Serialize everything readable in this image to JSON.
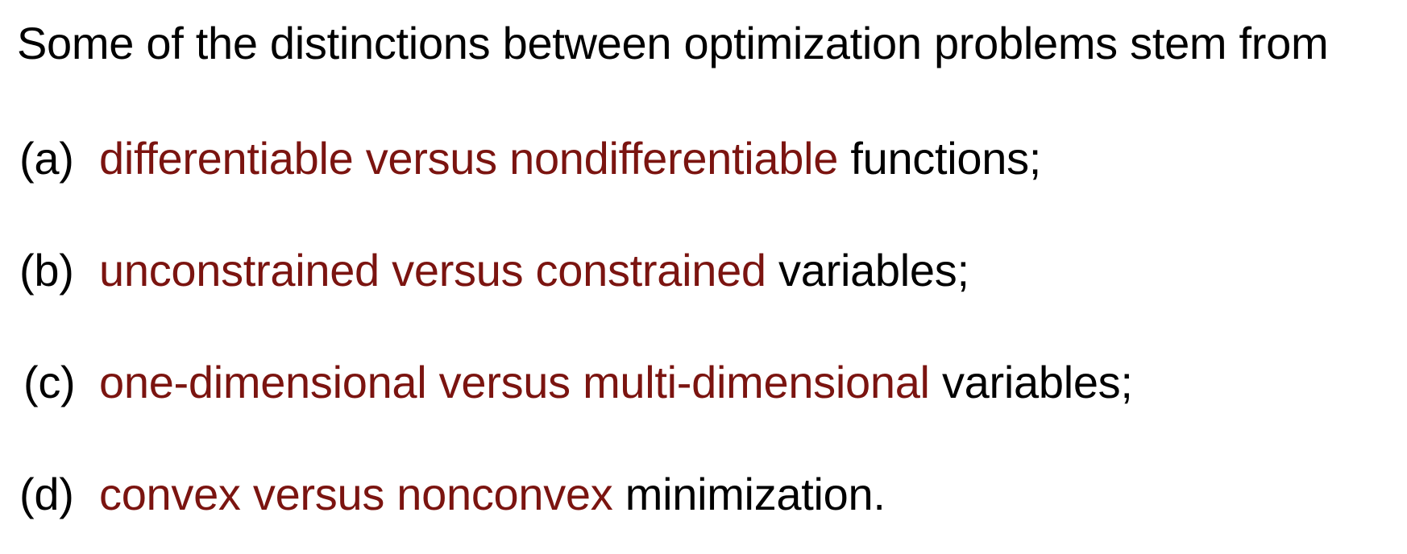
{
  "intro": "Some of the distinctions between optimization problems stem from",
  "items": [
    {
      "marker": "(a)",
      "highlight": "differentiable versus nondifferentiable",
      "rest": "functions;"
    },
    {
      "marker": "(b)",
      "highlight": "unconstrained versus constrained",
      "rest": "variables;"
    },
    {
      "marker": "(c)",
      "highlight": "one-dimensional versus multi-dimensional",
      "rest": "variables;"
    },
    {
      "marker": "(d)",
      "highlight": "convex versus nonconvex",
      "rest": "minimization."
    }
  ],
  "colors": {
    "text": "#000000",
    "highlight": "#7b1410",
    "background": "#ffffff"
  }
}
